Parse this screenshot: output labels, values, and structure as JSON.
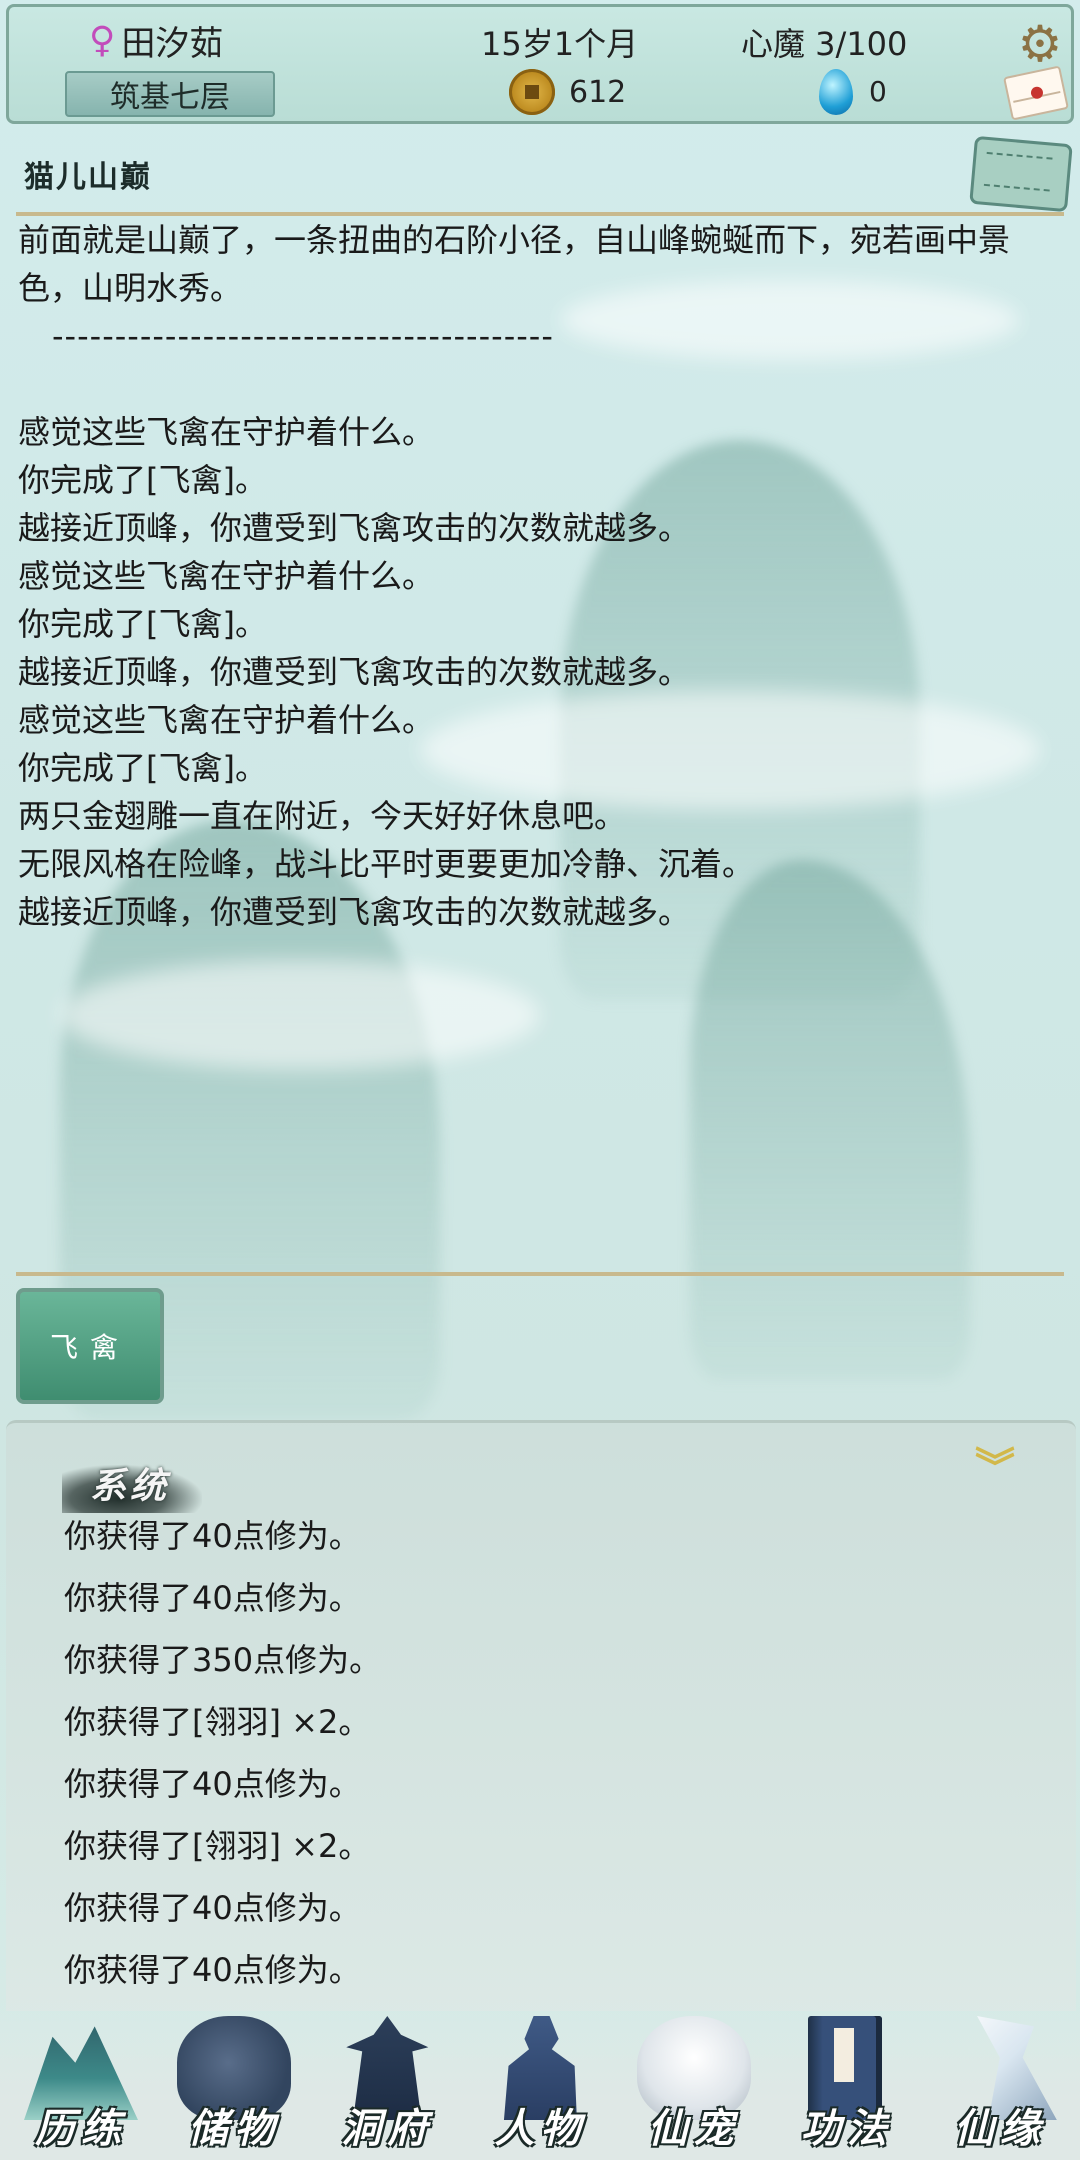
{
  "header": {
    "gender_icon": "♀",
    "name": "田汐茹",
    "realm": "筑基七层",
    "age": "15岁1个月",
    "coins": "612",
    "demon": "心魔  3/100",
    "gems": "0"
  },
  "location": {
    "title": "猫儿山巅"
  },
  "story": {
    "intro": "前面就是山巅了，一条扭曲的石阶小径，自山峰蜿蜒而下，宛若画中景色，山明水秀。",
    "separator": "----------------------------------------",
    "lines": [
      "感觉这些飞禽在守护着什么。",
      "你完成了[飞禽]。",
      "越接近顶峰，你遭受到飞禽攻击的次数就越多。",
      "感觉这些飞禽在守护着什么。",
      "你完成了[飞禽]。",
      "越接近顶峰，你遭受到飞禽攻击的次数就越多。",
      "感觉这些飞禽在守护着什么。",
      "你完成了[飞禽]。",
      "两只金翅雕一直在附近，今天好好休息吧。",
      "无限风格在险峰，战斗比平时更要更加冷静、沉着。",
      "越接近顶峰，你遭受到飞禽攻击的次数就越多。"
    ]
  },
  "action": {
    "label": "飞禽"
  },
  "system": {
    "title": "系统",
    "lines": [
      "你获得了40点修为。",
      "你获得了40点修为。",
      "你获得了350点修为。",
      "你获得了[翎羽] ×2。",
      "你获得了40点修为。",
      "你获得了[翎羽] ×2。",
      "你获得了40点修为。",
      "你获得了40点修为。"
    ]
  },
  "nav": {
    "items": [
      {
        "label": "历练",
        "icon": "mountain-icon"
      },
      {
        "label": "储物",
        "icon": "bag-icon"
      },
      {
        "label": "洞府",
        "icon": "pagoda-icon"
      },
      {
        "label": "人物",
        "icon": "person-icon"
      },
      {
        "label": "仙宠",
        "icon": "pet-icon"
      },
      {
        "label": "功法",
        "icon": "book-icon"
      },
      {
        "label": "仙缘",
        "icon": "fate-icon"
      }
    ]
  }
}
